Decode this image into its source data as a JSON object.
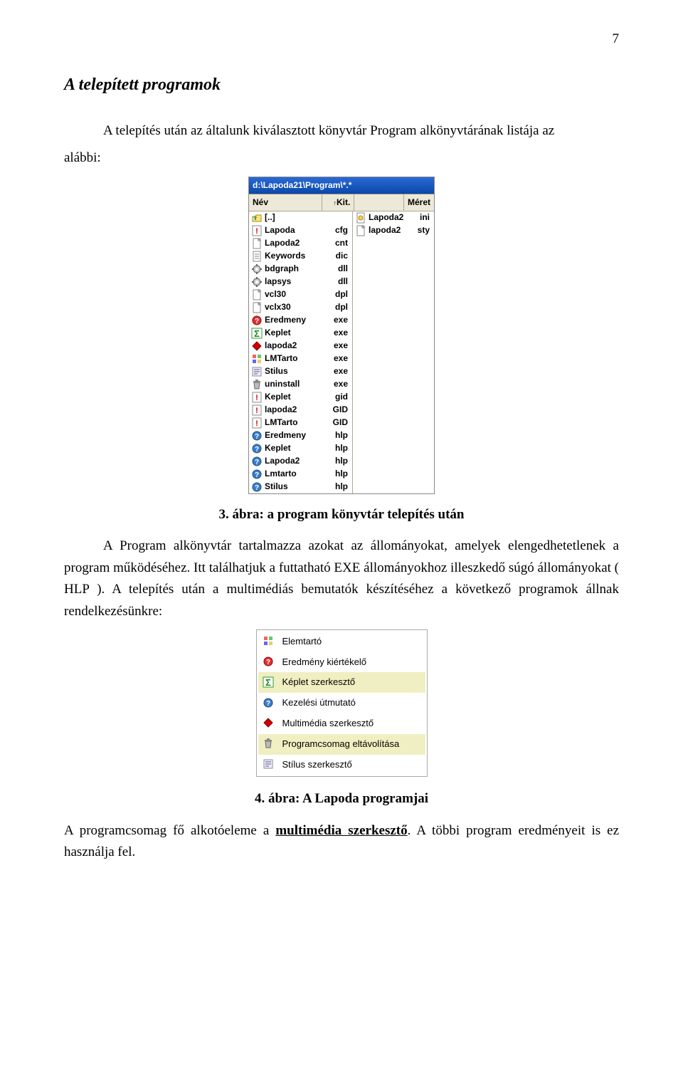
{
  "page_number": "7",
  "heading": "A telepített programok",
  "para1_pre": "A telepítés után az általunk kiválasztott könyvtár Program alkönyvtárának listája az",
  "para1_post": "alábbi:",
  "panel": {
    "path": "d:\\Lapoda21\\Program\\*.*",
    "col_name": "Név",
    "col_name_arrow": "↑",
    "col_ext": "Kit.",
    "col_size": "Méret",
    "left_files": [
      {
        "icon": "updir",
        "name": "[..]",
        "ext": ""
      },
      {
        "icon": "excl",
        "name": "Lapoda",
        "ext": "cfg"
      },
      {
        "icon": "doc",
        "name": "Lapoda2",
        "ext": "cnt"
      },
      {
        "icon": "text",
        "name": "Keywords",
        "ext": "dic"
      },
      {
        "icon": "gear",
        "name": "bdgraph",
        "ext": "dll"
      },
      {
        "icon": "gear",
        "name": "lapsys",
        "ext": "dll"
      },
      {
        "icon": "doc",
        "name": "vcl30",
        "ext": "dpl"
      },
      {
        "icon": "doc",
        "name": "vclx30",
        "ext": "dpl"
      },
      {
        "icon": "qred",
        "name": "Eredmeny",
        "ext": "exe"
      },
      {
        "icon": "sigma",
        "name": "Keplet",
        "ext": "exe"
      },
      {
        "icon": "diamond",
        "name": "lapoda2",
        "ext": "exe"
      },
      {
        "icon": "mosaic",
        "name": "LMTarto",
        "ext": "exe"
      },
      {
        "icon": "stilus",
        "name": "Stilus",
        "ext": "exe"
      },
      {
        "icon": "trash",
        "name": "uninstall",
        "ext": "exe"
      },
      {
        "icon": "excl",
        "name": "Keplet",
        "ext": "gid"
      },
      {
        "icon": "excl",
        "name": "lapoda2",
        "ext": "GID"
      },
      {
        "icon": "excl",
        "name": "LMTarto",
        "ext": "GID"
      },
      {
        "icon": "help",
        "name": "Eredmeny",
        "ext": "hlp"
      },
      {
        "icon": "help",
        "name": "Keplet",
        "ext": "hlp"
      },
      {
        "icon": "help",
        "name": "Lapoda2",
        "ext": "hlp"
      },
      {
        "icon": "help",
        "name": "Lmtarto",
        "ext": "hlp"
      },
      {
        "icon": "help",
        "name": "Stilus",
        "ext": "hlp"
      }
    ],
    "right_files": [
      {
        "icon": "ini",
        "name": "Lapoda2",
        "ext": "ini"
      },
      {
        "icon": "doc",
        "name": "lapoda2",
        "ext": "sty"
      }
    ]
  },
  "caption1": "3. ábra: a program könyvtár telepítés után",
  "para2": "A Program alkönyvtár tartalmazza azokat az állományokat, amelyek elengedhetetlenek a program működéséhez. Itt találhatjuk a futtatható EXE állományokhoz illeszkedő súgó állományokat ( HLP ). A telepítés után a multimédiás bemutatók készítéséhez a következő programok állnak rendelkezésünkre:",
  "menu": {
    "items": [
      {
        "icon": "mosaic",
        "label": "Elemtartó",
        "highlight": false
      },
      {
        "icon": "qred",
        "label": "Eredmény kiértékelő",
        "highlight": false
      },
      {
        "icon": "sigma",
        "label": "Képlet szerkesztő",
        "highlight": true
      },
      {
        "icon": "help",
        "label": "Kezelési útmutató",
        "highlight": false
      },
      {
        "icon": "diamond",
        "label": "Multimédia szerkesztő",
        "highlight": false
      },
      {
        "icon": "trash",
        "label": "Programcsomag eltávolítása",
        "highlight": true
      },
      {
        "icon": "stilus",
        "label": "Stílus szerkesztő",
        "highlight": false
      }
    ]
  },
  "caption2": "4. ábra: A Lapoda programjai",
  "para3_pre": "A programcsomag fő alkotóeleme a ",
  "para3_strong": "multimédia szerkesztő",
  "para3_post": ". A többi program eredményeit is ez használja fel."
}
